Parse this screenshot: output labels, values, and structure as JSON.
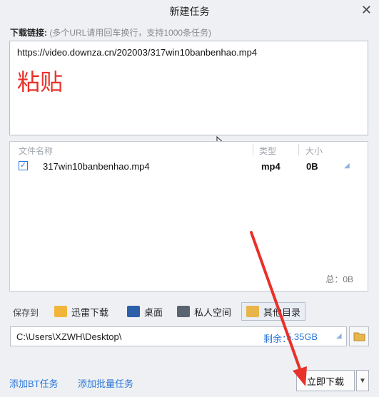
{
  "dialog": {
    "title": "新建任务"
  },
  "link": {
    "label": "下载链接:",
    "hint": "(多个URL请用回车换行，支持1000条任务)",
    "url": "https://video.downza.cn/202003/317win10banbenhao.mp4",
    "annotation": "粘贴"
  },
  "file_list": {
    "headers": [
      "文件名称",
      "类型",
      "大小"
    ],
    "rows": [
      {
        "name": "317win10banbenhao.mp4",
        "type": "mp4",
        "size": "0B",
        "checked": true
      }
    ],
    "total": "总：0B"
  },
  "save": {
    "label": "保存到",
    "options": [
      {
        "label": "迅雷下载",
        "icon": "thunder-folder-icon"
      },
      {
        "label": "桌面",
        "icon": "desktop-icon"
      },
      {
        "label": "私人空间",
        "icon": "private-space-icon"
      },
      {
        "label": "其他目录",
        "icon": "folder-icon",
        "selected": true
      }
    ],
    "path": "C:\\Users\\XZWH\\Desktop\\",
    "free_label": "剩余：",
    "free_value": "5.35GB"
  },
  "footer": {
    "add_bt": "添加BT任务",
    "add_batch": "添加批量任务",
    "download_now": "立即下载"
  },
  "colors": {
    "accent": "#2b78d8",
    "annotation_red": "#e8312a"
  }
}
